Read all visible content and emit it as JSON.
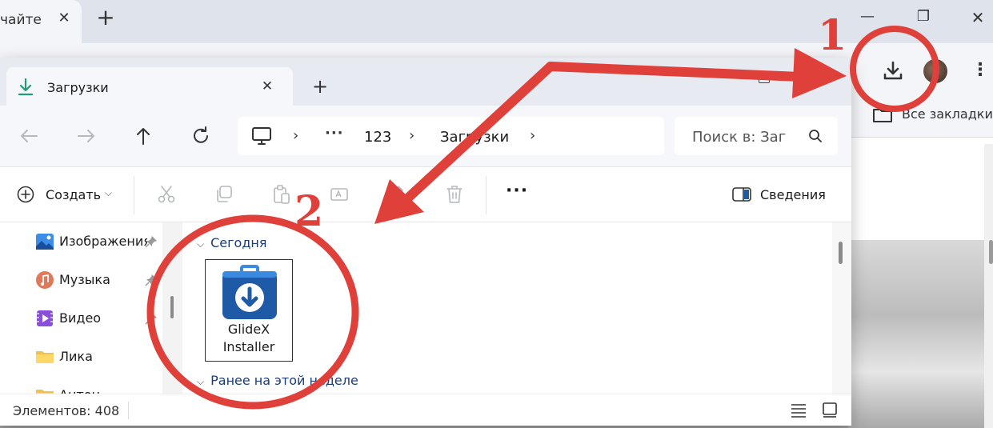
{
  "browser": {
    "tab_title": "чайте р",
    "tab_close": "✕",
    "new_tab": "+",
    "window": {
      "minimize": "—",
      "maximize": "❐",
      "close": "✕"
    },
    "menu": "⋮",
    "bookmarks_label": "Все закладки",
    "icons": [
      "download-icon",
      "avatar",
      "kebab-menu-icon",
      "folder-icon"
    ]
  },
  "explorer": {
    "tab_title": "Загрузки",
    "tab_close": "✕",
    "new_tab": "+",
    "nav": {
      "back": "←",
      "forward": "→",
      "up": "↑",
      "refresh": "↻"
    },
    "address": {
      "more": "···",
      "separator": "›",
      "crumbs": [
        "123",
        "Загрузки"
      ]
    },
    "search": {
      "placeholder": "Поиск в: Загрузки"
    },
    "command_bar": {
      "new_label": "Создать",
      "new_caret": "⌵",
      "more": "···",
      "details_label": "Сведения"
    },
    "sidebar": {
      "items": [
        {
          "label": "Изображения",
          "icon": "pictures-icon",
          "pinned": true
        },
        {
          "label": "Музыка",
          "icon": "music-icon",
          "pinned": true
        },
        {
          "label": "Видео",
          "icon": "video-icon",
          "pinned": true
        },
        {
          "label": "Лика",
          "icon": "folder-icon",
          "pinned": false
        },
        {
          "label": "Антон",
          "icon": "folder-icon",
          "pinned": false
        }
      ]
    },
    "content": {
      "group_today": "Сегодня",
      "group_earlier": "Ранее на этой неделе",
      "file": {
        "name": "GlideX Installer",
        "icon": "installer-icon"
      }
    },
    "status": {
      "count": "Элементов: 408"
    }
  },
  "annotations": {
    "badge1": "1",
    "badge2": "2",
    "color": "#e0403a"
  },
  "colors": {
    "accent_red": "#e0403a",
    "installer_blue": "#1f5aa6",
    "group_header": "#1a3d7a"
  }
}
